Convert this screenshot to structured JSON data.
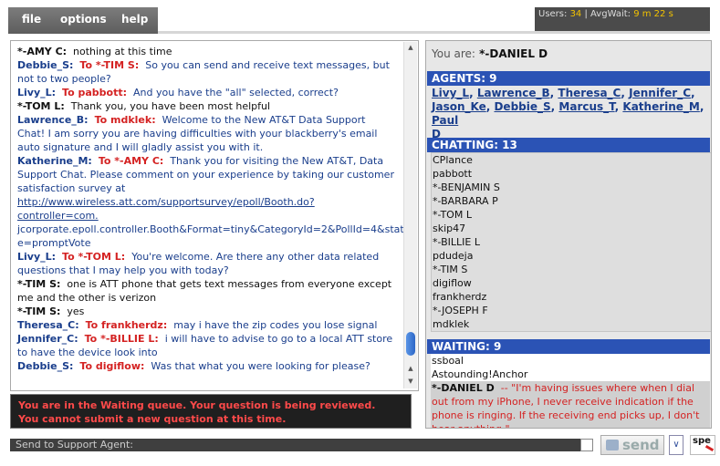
{
  "menu": {
    "file": "file",
    "options": "options",
    "help": "help"
  },
  "stats": {
    "users_label": "Users:",
    "users_value": "34",
    "sep": "|",
    "avgwait_label": "AvgWait:",
    "avgwait_value": "9 m 22 s"
  },
  "chat": {
    "lines": [
      {
        "from": "*-AMY C:",
        "from_kind": "cust",
        "to": "",
        "text": "nothing at this time"
      },
      {
        "from": "Debbie_S:",
        "from_kind": "agent",
        "to": "To *-TIM S:",
        "text": "So you can send and receive text messages, but not to two people?"
      },
      {
        "from": "Livy_L:",
        "from_kind": "agent",
        "to": "To pabbott:",
        "text": "And you have the \"all\" selected, correct?"
      },
      {
        "from": "*-TOM L:",
        "from_kind": "cust",
        "to": "",
        "text": "Thank you, you have been most helpful"
      },
      {
        "from": "Lawrence_B:",
        "from_kind": "agent",
        "to": "To mdklek:",
        "text": "Welcome to the New AT&T Data Support Chat! I am sorry you are having difficulties with your blackberry's email auto signature and I will gladly assist you with it."
      },
      {
        "from": "Katherine_M:",
        "from_kind": "agent",
        "to": "To *-AMY C:",
        "text": "Thank you for visiting the New AT&T, Data Support Chat. Please comment on your experience by taking our customer satisfaction survey at",
        "link": "http://www.wireless.att.com/supportsurvey/epoll/Booth.do?controller=com.",
        "after": "jcorporate.epoll.controller.Booth&Format=tiny&CategoryId=2&PollId=4&stat e=promptVote"
      },
      {
        "from": "Livy_L:",
        "from_kind": "agent",
        "to": "To *-TOM L:",
        "text": "You're welcome. Are there any other data related questions that I may help you with today?"
      },
      {
        "from": "*-TIM S:",
        "from_kind": "cust",
        "to": "",
        "text": "one is ATT phone that gets text messages from everyone except me and the other is verizon"
      },
      {
        "from": "*-TIM S:",
        "from_kind": "cust",
        "to": "",
        "text": "yes"
      },
      {
        "from": "Theresa_C:",
        "from_kind": "agent",
        "to": "To frankherdz:",
        "text": "may i have the zip codes you lose signal"
      },
      {
        "from": "Jennifer_C:",
        "from_kind": "agent",
        "to": "To *-BILLIE L:",
        "text": "i will have to advise to go to a local ATT store to have the device look into"
      },
      {
        "from": "Debbie_S:",
        "from_kind": "agent",
        "to": "To digiflow:",
        "text": "Was that what you were looking for please?"
      }
    ]
  },
  "status": {
    "line1": "You are in the Waiting queue.  Your question is being reviewed.",
    "line2": "You cannot submit a new question at this time."
  },
  "panel": {
    "you_label": "You are:",
    "you_name": "*-DANIEL D",
    "agents_header": "AGENTS: 9",
    "agents": [
      "Livy_L",
      "Lawrence_B",
      "Theresa_C",
      "Jennifer_C",
      "Jason_Ke",
      "Debbie_S",
      "Marcus_T",
      "Katherine_M",
      "Paul",
      "D"
    ],
    "chatting_header": "CHATTING: 13",
    "chatting": [
      "CPlance",
      "pabbott",
      "*-BENJAMIN S",
      "*-BARBARA P",
      "*-TOM L",
      "skip47",
      "*-BILLIE L",
      "pdudeja",
      "*-TIM S",
      "digiflow",
      "frankherdz",
      "*-JOSEPH F",
      "mdklek"
    ],
    "waiting_header": "WAITING: 9",
    "waiting": [
      "ssboal",
      "Astounding!Anchor"
    ],
    "waiting_self_name": "*-DANIEL D",
    "waiting_self_msg": "-- \"I'm having issues where when I dial out from my iPhone, I never receive indication if the phone is ringing.  If the receiving end picks up, I don't hear anything.\""
  },
  "sendbar": {
    "label": "Send to Support Agent:",
    "send": "send",
    "dropdown": "∨",
    "spe": "spe"
  }
}
